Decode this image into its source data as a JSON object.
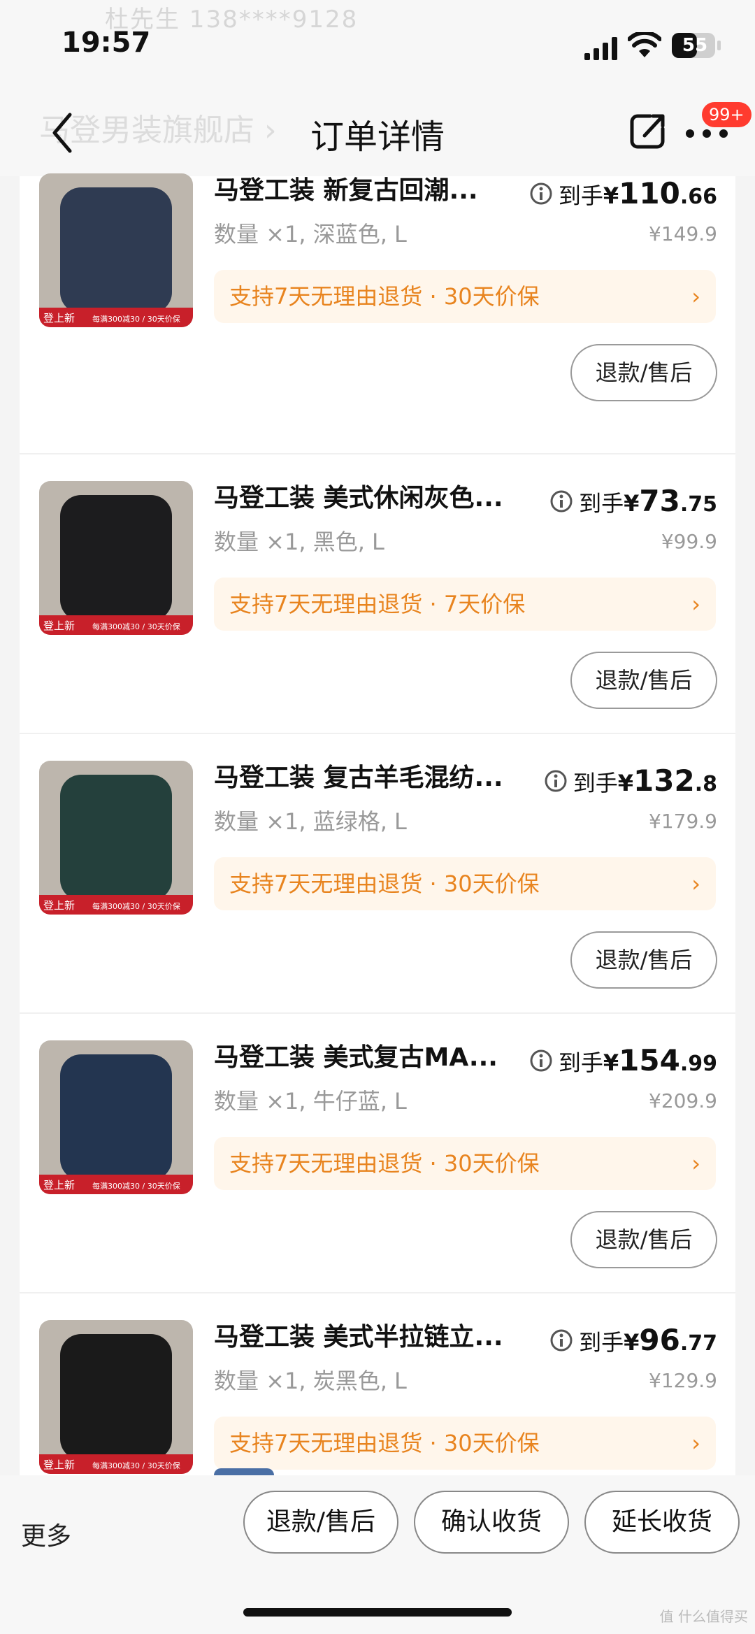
{
  "status_bar": {
    "ghost_contact": "杜先生  138****9128",
    "time": "19:57",
    "battery": "55"
  },
  "nav": {
    "ghost_store": "马登男装旗舰店  ›",
    "title": "订单详情",
    "badge": "99+"
  },
  "items": [
    {
      "title": "马登工装 新复古回潮...",
      "spec": "数量 ×1, 深蓝色, L",
      "price_label": "到手",
      "price_yen": "¥",
      "price_int": "110",
      "price_dec": ".66",
      "orig_price": "¥149.9",
      "guarantee": "支持7天无理由退货 · 30天价保",
      "refund": "退款/售后",
      "thumb_color": "#2f3b52"
    },
    {
      "title": "马登工装 美式休闲灰色...",
      "spec": "数量 ×1, 黑色, L",
      "price_label": "到手",
      "price_yen": "¥",
      "price_int": "73",
      "price_dec": ".75",
      "orig_price": "¥99.9",
      "guarantee": "支持7天无理由退货 · 7天价保",
      "refund": "退款/售后",
      "thumb_color": "#1c1c1e"
    },
    {
      "title": "马登工装 复古羊毛混纺...",
      "spec": "数量 ×1, 蓝绿格, L",
      "price_label": "到手",
      "price_yen": "¥",
      "price_int": "132",
      "price_dec": ".8",
      "orig_price": "¥179.9",
      "guarantee": "支持7天无理由退货 · 30天价保",
      "refund": "退款/售后",
      "thumb_color": "#24403c"
    },
    {
      "title": "马登工装 美式复古MA...",
      "spec": "数量 ×1, 牛仔蓝, L",
      "price_label": "到手",
      "price_yen": "¥",
      "price_int": "154",
      "price_dec": ".99",
      "orig_price": "¥209.9",
      "guarantee": "支持7天无理由退货 · 30天价保",
      "refund": "退款/售后",
      "thumb_color": "#233550"
    },
    {
      "title": "马登工装 美式半拉链立...",
      "spec": "数量 ×1, 炭黑色, L",
      "price_label": "到手",
      "price_yen": "¥",
      "price_int": "96",
      "price_dec": ".77",
      "orig_price": "¥129.9",
      "guarantee": "支持7天无理由退货 · 30天价保",
      "refund": "退款/售后",
      "thumb_color": "#1a1a1a"
    }
  ],
  "thumb_banner": {
    "left": "登上新",
    "right": "每满300减30 / 30天价保"
  },
  "bottom": {
    "more": "更多",
    "refund": "退款/售后",
    "confirm": "确认收货",
    "extend": "延长收货"
  },
  "watermark": "值 什么值得买"
}
